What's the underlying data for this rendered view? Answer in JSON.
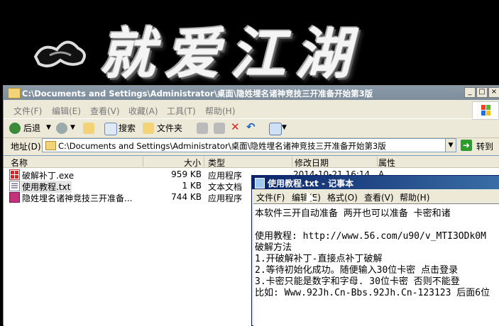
{
  "banner": {
    "text": "就爱江湖"
  },
  "explorer": {
    "title": "C:\\Documents and Settings\\Administrator\\桌面\\隐姓埋名诸神竞技三开准备开始第3版",
    "menu": [
      "文件(F)",
      "编辑(E)",
      "查看(V)",
      "收藏(A)",
      "工具(T)",
      "帮助(H)"
    ],
    "toolbar": {
      "back": "后退",
      "search": "搜索",
      "folders": "文件夹",
      "go": "转到"
    },
    "address": {
      "label": "地址(D)",
      "value": "C:\\Documents and Settings\\Administrator\\桌面\\隐姓埋名诸神竞技三开准备开始第3版"
    },
    "columns": [
      "名称",
      "大小",
      "类型",
      "修改日期",
      "属性"
    ],
    "files": [
      {
        "name": "破解补丁.exe",
        "size": "959 KB",
        "type": "应用程序",
        "date": "2014-10-21 16:14",
        "attr": "A",
        "icon": "exe-icon"
      },
      {
        "name": "使用教程.txt",
        "size": "1 KB",
        "type": "文本文档",
        "date": "",
        "attr": "",
        "icon": "text-file-icon"
      },
      {
        "name": "隐姓埋名诸神竞技三开准备...",
        "size": "744 KB",
        "type": "应用程序",
        "date": "",
        "attr": "",
        "icon": "app-icon"
      }
    ]
  },
  "notepad": {
    "title": "使用教程.txt - 记事本",
    "menu": [
      "文件(F)",
      "编辑(E)",
      "格式(O)",
      "查看(V)",
      "帮助(H)"
    ],
    "lines": [
      "本软件三开自动准备  两开也可以准备 卡密和诸",
      "",
      "使用教程: http://www.56.com/u90/v_MTI3ODk0M",
      "破解方法",
      "1.开破解补丁-直接点补丁破解",
      "2.等待初始化成功。随便输入30位卡密 点击登录",
      "3.卡密只能是数字和字母. 30位卡密 否则不能登",
      "比如: Www.92Jh.Cn-Bbs.92Jh.Cn-123123 后面6位"
    ]
  },
  "colors": {
    "title_bar_active": "#0a246a",
    "title_bar_inactive": "#7d8d9b",
    "window_bg": "#ece9d8"
  }
}
